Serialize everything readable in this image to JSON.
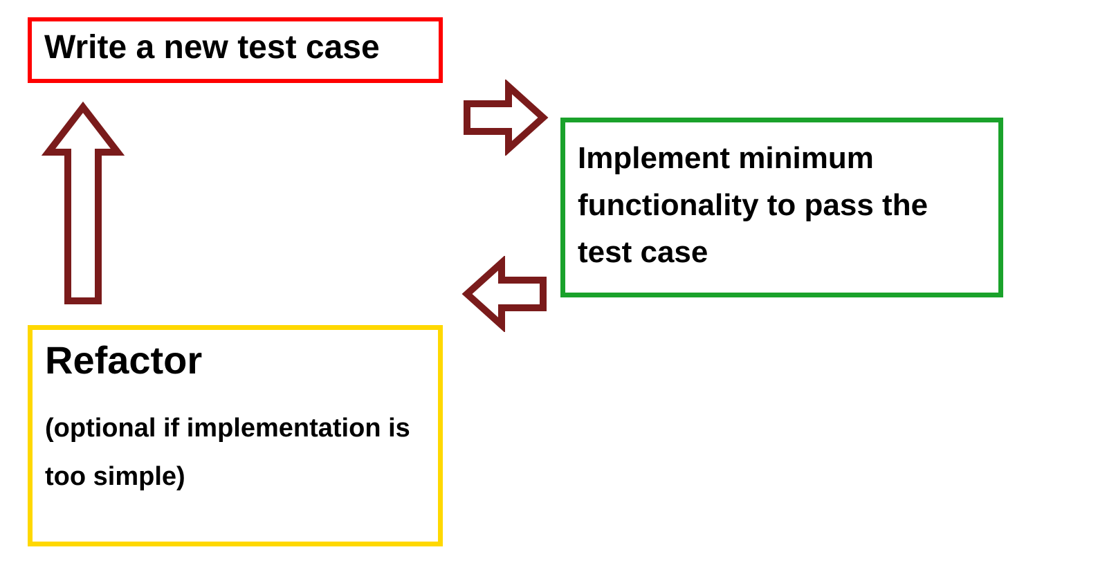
{
  "boxes": {
    "write_test": {
      "text": "Write a new test case",
      "border_color": "#ff0000"
    },
    "implement": {
      "text": "Implement minimum functionality to pass the test case",
      "border_color": "#1aa22b"
    },
    "refactor": {
      "title": "Refactor",
      "subtitle": "(optional if implementation is too simple)",
      "border_color": "#ffd800"
    }
  },
  "arrows": {
    "color": "#7a1b1b",
    "right": {
      "from": "write_test",
      "to": "implement"
    },
    "left": {
      "from": "implement",
      "to": "refactor"
    },
    "up": {
      "from": "refactor",
      "to": "write_test"
    }
  }
}
